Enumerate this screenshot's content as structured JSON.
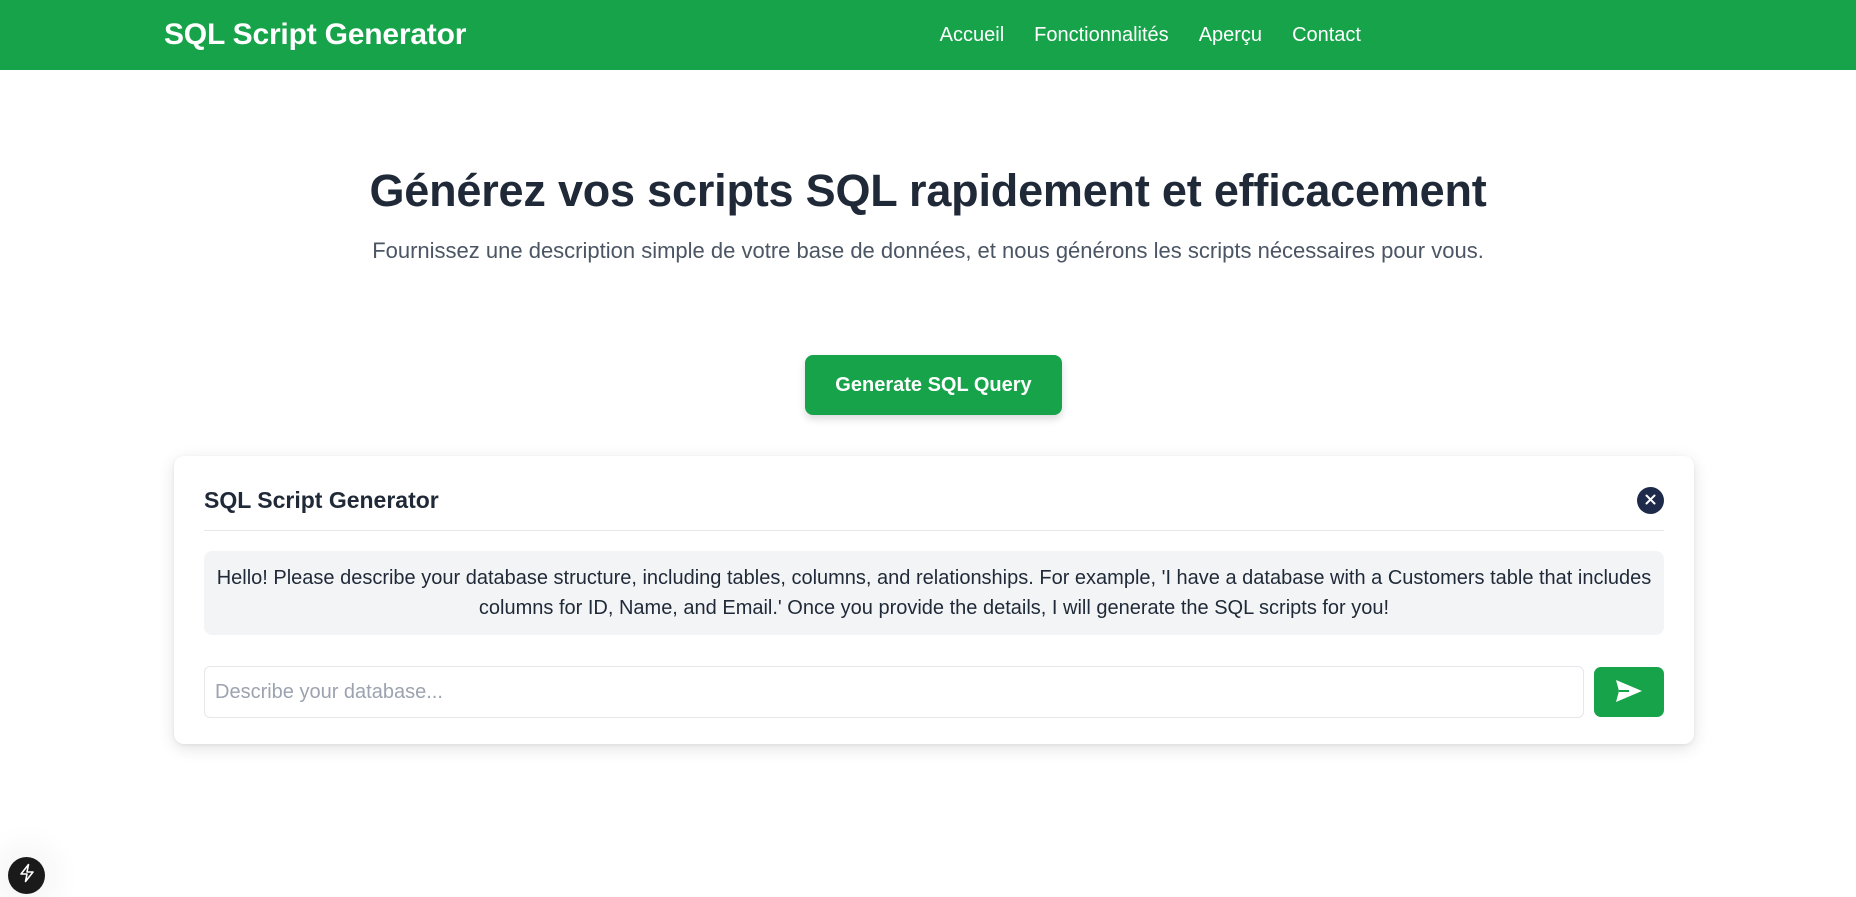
{
  "navbar": {
    "brand": "SQL Script Generator",
    "links": [
      {
        "label": "Accueil"
      },
      {
        "label": "Fonctionnalités"
      },
      {
        "label": "Aperçu"
      },
      {
        "label": "Contact"
      }
    ]
  },
  "hero": {
    "title": "Générez vos scripts SQL rapidement et efficacement",
    "subtitle": "Fournissez une description simple de votre base de données, et nous générons les scripts nécessaires pour vous."
  },
  "cta": {
    "label": "Generate SQL Query"
  },
  "chat": {
    "title": "SQL Script Generator",
    "close_icon": "close-icon",
    "bot_message": "Hello! Please describe your database structure, including tables, columns, and relationships. For example, 'I have a database with a Customers table that includes columns for ID, Name, and Email.' Once you provide the details, I will generate the SQL scripts for you!",
    "input": {
      "value": "",
      "placeholder": "Describe your database..."
    },
    "send_icon": "send-icon"
  },
  "dev_badge": {
    "icon": "lightning-icon"
  },
  "colors": {
    "brand_green": "#16a34a",
    "close_navy": "#1e2a4a",
    "message_bg": "#f3f4f6"
  }
}
